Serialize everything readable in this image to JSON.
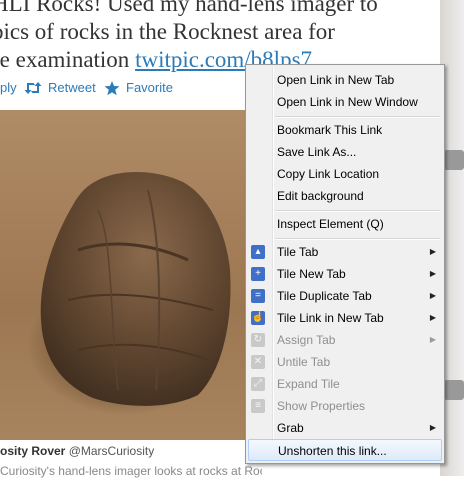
{
  "tweet": {
    "line1": "HLI Rocks! Used my hand-lens imager to",
    "line2": " pics of rocks in the Rocknest area for",
    "line3_prefix": "re examination ",
    "link": "twitpic.com/b8lps7"
  },
  "actions": {
    "reply": "ply",
    "retweet": "Retweet",
    "favorite": "Favorite"
  },
  "credit": {
    "name": "osity Rover",
    "handle": "@MarsCuriosity"
  },
  "bottom_text": "Curiosity's hand-lens imager looks at rocks at Rocknest",
  "menu": {
    "open_new_tab": "Open Link in New Tab",
    "open_new_window": "Open Link in New Window",
    "bookmark": "Bookmark This Link",
    "save_link": "Save Link As...",
    "copy_location": "Copy Link Location",
    "edit_background": "Edit background",
    "inspect": "Inspect Element (Q)",
    "tile_tab": "Tile Tab",
    "tile_new_tab": "Tile New Tab",
    "tile_duplicate": "Tile Duplicate Tab",
    "tile_link_new_tab": "Tile Link in New Tab",
    "assign_tab": "Assign Tab",
    "untile_tab": "Untile Tab",
    "expand_tile": "Expand Tile",
    "show_properties": "Show Properties",
    "grab": "Grab",
    "unshorten": "Unshorten this link..."
  },
  "colors": {
    "link": "#2b7bb9",
    "menu_bg": "#f0f0f0",
    "tile_icon_blue": "#3f6fc6"
  }
}
